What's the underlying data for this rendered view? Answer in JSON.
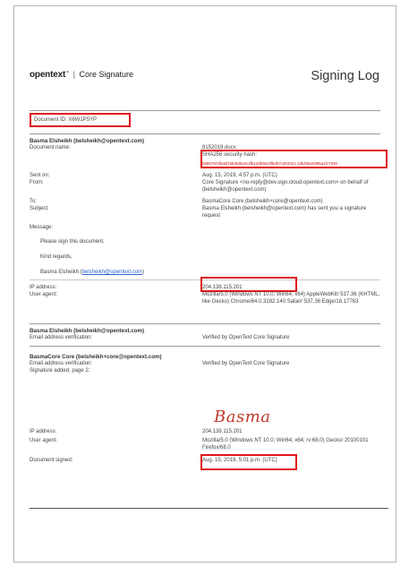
{
  "header": {
    "brand": "opentext",
    "tm": "™",
    "separator": "|",
    "product": "Core Signature",
    "title": "Signing Log"
  },
  "document_id": "Document ID: X6W1P5YP",
  "sender_block": {
    "heading": "Basma Elsheikh (belsheikh@opentext.com)",
    "doc_name_label": "Document name:",
    "doc_name": "8152019.docx",
    "sha_label": "SHA256 security hash:",
    "sha_value": "5066797dba6f1fab9d5a4c3fb12db56c9fbd87cd03321 1db405e6395a1fc7946",
    "sent_on_label": "Sent on:",
    "sent_on": "Aug. 15, 2019, 4:57 p.m. (UTC)",
    "from_label": "From:",
    "from": "Core Signature <no-reply@dev.sign.cloud.opentext.com> on behalf of (belsheikh@opentext.com)",
    "to_label": "To:",
    "to": "BasmaCore Core (belsheikh+core@opentext.com)",
    "subject_label": "Subject:",
    "subject": "Basma Elsheikh (belsheikh@opentext.com) has sent you a signature request",
    "message_label": "Message:",
    "message_lines": [
      "Please sign this document.",
      "Kind regards,"
    ],
    "message_sign_name": "Basma Elsheikh (",
    "message_sign_email": "belsheikh@opentext.com",
    "message_sign_close": ")",
    "ip_label": "IP address:",
    "ip": "204.138.115.201",
    "ua_label": "User agent:",
    "ua": "Mozilla/5.0 (Windows NT 10.0; Win64; x64) AppleWebKit/ 537.36 (KHTML, like Gecko) Chrome/64.0.3282.140 Safari/ 537.36 Edge/18.17763"
  },
  "verify_block": {
    "heading": "Basma Elsheikh (belsheikh@opentext.com)",
    "email_label": "Email address verification:",
    "email_value": "Verified by OpenText Core Signature"
  },
  "signer_block": {
    "heading": "BasmaCore Core (belsheikh+core@opentext.com)",
    "email_label": "Email address verification:",
    "email_value": "Verified by OpenText Core Signature",
    "sig_label": "Signature added, page 2:",
    "signature_text": "Basma",
    "ip_label": "IP address:",
    "ip": "204.138.115.201",
    "ua_label": "User agent:",
    "ua": "Mozilla/5.0 (Windows NT 10.0; Win64; x64; rv:68.0) Gecko/ 20100101 Firefox/68.0",
    "signed_label": "Document signed:",
    "signed": "Aug. 15, 2019, 5:01 p.m. (UTC)"
  },
  "colors": {
    "highlight": "#e0161b",
    "link": "#2a62c9",
    "signature": "#c0392b"
  }
}
